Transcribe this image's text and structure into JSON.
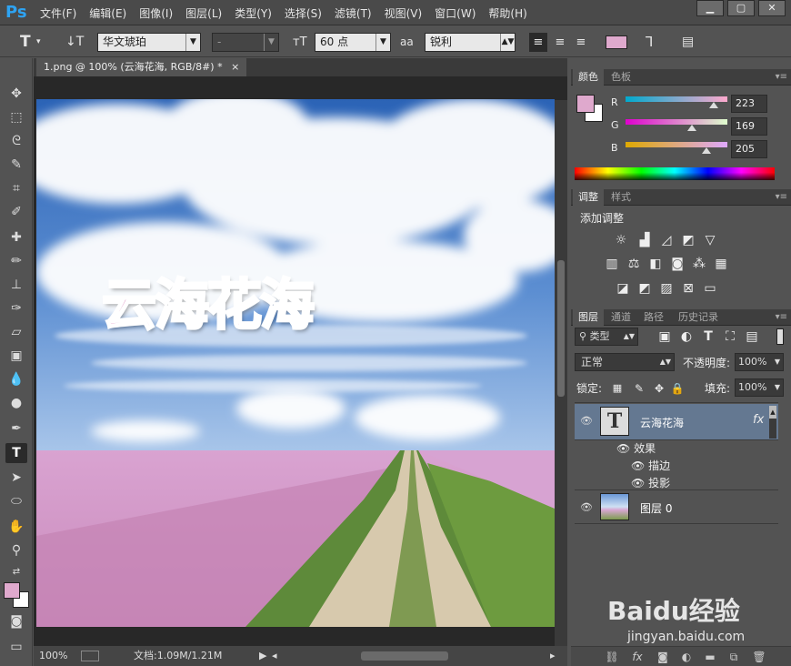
{
  "app": {
    "logo": "Ps"
  },
  "menu": [
    "文件(F)",
    "编辑(E)",
    "图像(I)",
    "图层(L)",
    "类型(Y)",
    "选择(S)",
    "滤镜(T)",
    "视图(V)",
    "窗口(W)",
    "帮助(H)"
  ],
  "options": {
    "font_family": "华文琥珀",
    "font_style": "-",
    "font_size": "60 点",
    "aa_icon": "aa",
    "antialias": "锐利",
    "text_color": "#dfa9cd"
  },
  "document": {
    "tab_title": "1.png @ 100% (云海花海, RGB/8#) *",
    "tab_close": "×",
    "canvas_text": "云海花海",
    "canvas_text_color": "#e6a9cf"
  },
  "status": {
    "zoom": "100%",
    "doc_info": "文档:1.09M/1.21M"
  },
  "color_panel": {
    "tabs": [
      "颜色",
      "色板"
    ],
    "foreground": "#dfa9cd",
    "background": "#ffffff",
    "channels": [
      {
        "label": "R",
        "value": "223"
      },
      {
        "label": "G",
        "value": "169"
      },
      {
        "label": "B",
        "value": "205"
      }
    ]
  },
  "adjust_panel": {
    "tabs": [
      "调整",
      "样式"
    ],
    "title": "添加调整"
  },
  "layers_panel": {
    "tabs": [
      "图层",
      "通道",
      "路径",
      "历史记录"
    ],
    "filter_kind": "类型",
    "blend_mode": "正常",
    "opacity_label": "不透明度:",
    "opacity": "100%",
    "lock_label": "锁定:",
    "fill_label": "填充:",
    "fill": "100%",
    "layers": [
      {
        "name": "云海花海",
        "thumb": "T",
        "fx": "fx",
        "effects_label": "效果",
        "effects": [
          "描边",
          "投影"
        ]
      },
      {
        "name": "图层 0"
      }
    ]
  },
  "watermark": {
    "brand": "Baidu经验",
    "url": "jingyan.baidu.com"
  }
}
